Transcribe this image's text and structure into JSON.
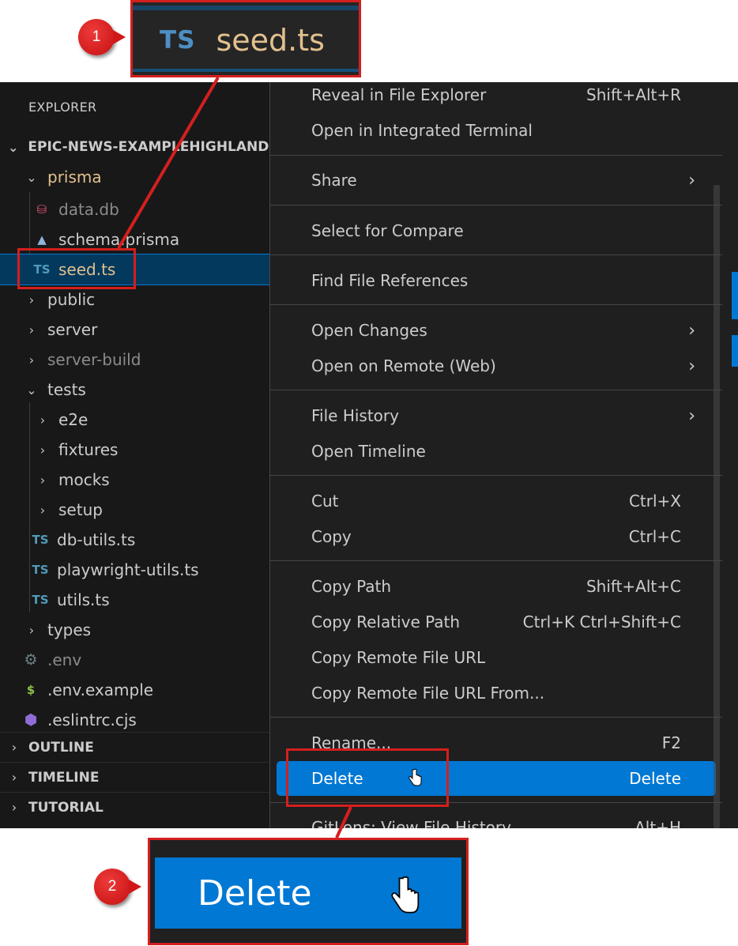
{
  "zoom_top": {
    "ts_icon": "TS",
    "filename": "seed.ts"
  },
  "badges": {
    "first": "1",
    "second": "2"
  },
  "explorer": {
    "title": "EXPLORER",
    "root": "EPIC-NEWS-EXAMPLEHIGHLANDS",
    "items": [
      {
        "label": "prisma",
        "chevron": "open",
        "icon": ""
      },
      {
        "label": "data.db",
        "icon": "database-icon"
      },
      {
        "label": "schema.prisma",
        "icon": "prisma-icon"
      },
      {
        "label": "seed.ts",
        "icon": "TS"
      },
      {
        "label": "public",
        "chevron": "closed"
      },
      {
        "label": "server",
        "chevron": "closed"
      },
      {
        "label": "server-build",
        "chevron": "closed"
      },
      {
        "label": "tests",
        "chevron": "open"
      },
      {
        "label": "e2e",
        "chevron": "closed"
      },
      {
        "label": "fixtures",
        "chevron": "closed"
      },
      {
        "label": "mocks",
        "chevron": "closed"
      },
      {
        "label": "setup",
        "chevron": "closed"
      },
      {
        "label": "db-utils.ts",
        "icon": "TS"
      },
      {
        "label": "playwright-utils.ts",
        "icon": "TS"
      },
      {
        "label": "utils.ts",
        "icon": "TS"
      },
      {
        "label": "types",
        "chevron": "closed"
      },
      {
        "label": ".env",
        "icon": "gear-icon"
      },
      {
        "label": ".env.example",
        "icon": "$"
      },
      {
        "label": ".eslintrc.cjs",
        "icon": "eslint-icon"
      }
    ],
    "sections": [
      "OUTLINE",
      "TIMELINE",
      "TUTORIAL"
    ]
  },
  "menu": {
    "items": [
      {
        "label": "Reveal in File Explorer",
        "shortcut": "Shift+Alt+R"
      },
      {
        "label": "Open in Integrated Terminal",
        "shortcut": ""
      },
      {
        "label": "Share",
        "shortcut": "",
        "submenu": true
      },
      {
        "label": "Select for Compare",
        "shortcut": ""
      },
      {
        "label": "Find File References",
        "shortcut": ""
      },
      {
        "label": "Open Changes",
        "shortcut": "",
        "submenu": true
      },
      {
        "label": "Open on Remote (Web)",
        "shortcut": "",
        "submenu": true
      },
      {
        "label": "File History",
        "shortcut": "",
        "submenu": true
      },
      {
        "label": "Open Timeline",
        "shortcut": ""
      },
      {
        "label": "Cut",
        "shortcut": "Ctrl+X"
      },
      {
        "label": "Copy",
        "shortcut": "Ctrl+C"
      },
      {
        "label": "Copy Path",
        "shortcut": "Shift+Alt+C"
      },
      {
        "label": "Copy Relative Path",
        "shortcut": "Ctrl+K Ctrl+Shift+C"
      },
      {
        "label": "Copy Remote File URL",
        "shortcut": ""
      },
      {
        "label": "Copy Remote File URL From...",
        "shortcut": ""
      },
      {
        "label": "Rename...",
        "shortcut": "F2"
      },
      {
        "label": "Delete",
        "shortcut": "Delete",
        "active": true
      },
      {
        "label": "GitLens: View File History",
        "shortcut": "Alt+H"
      }
    ],
    "submenu_arrow": "›"
  },
  "zoom_bottom": {
    "label": "Delete"
  },
  "colors": {
    "accent": "#0078d4",
    "callout_red": "#d41f1f",
    "sidebar_bg": "#181818",
    "menu_bg": "#1f1f1f"
  }
}
